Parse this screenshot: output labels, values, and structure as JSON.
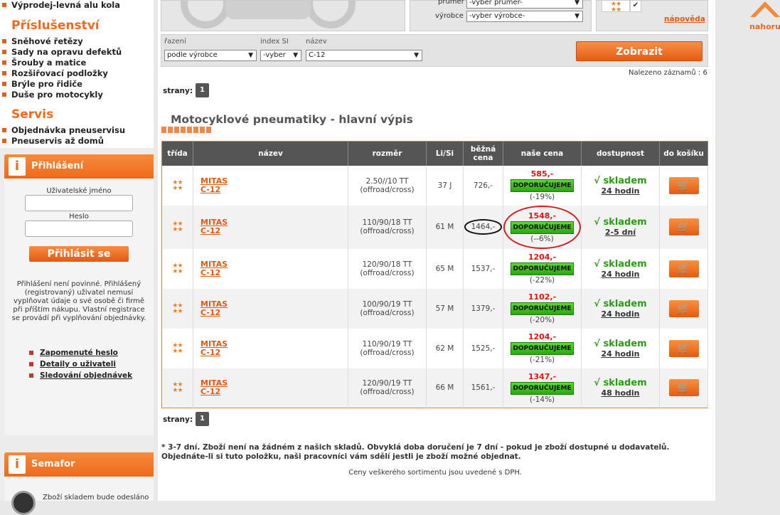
{
  "sidebar": {
    "top_item": "Výprodej-levná alu kola",
    "section_accessories": "Příslušenství",
    "accessories": [
      "Sněhové řetězy",
      "Sady na opravu defektů",
      "Šrouby a matice",
      "Rozšiřovací podložky",
      "Brýle pro řidiče",
      "Duše pro motocykly"
    ],
    "section_service": "Servis",
    "service": [
      "Objednávka pneuservisu",
      "Pneuservis až domů"
    ],
    "login": {
      "title": "Přihlášení",
      "username_label": "Uživatelské jméno",
      "password_label": "Heslo",
      "button": "Přihlásit se",
      "note": "Přihlášení není povinné. Přihlášený (registrovaný) uživatel nemusí vyplňovat údaje o své osobě či firmě při příštím nákupu. Vlastní registrace se provádí při vyplňování objednávky.",
      "links": [
        "Zapomenuté heslo",
        "Detaily o uživateli",
        "Sledování objednávek"
      ]
    },
    "semafor": {
      "title": "Semafor",
      "text": "Zboží skladem bude odesláno"
    }
  },
  "top": {
    "prumer_label": "průměr",
    "prumer_value": "-vyber průměr-",
    "vyrobce_label": "výrobce",
    "vyrobce_value": "-vyber výrobce-",
    "napoveda": "nápověda",
    "nahoru": "nahoru"
  },
  "filters": {
    "razeni_label": "řazení",
    "razeni_value": "podle výrobce",
    "index_label": "index SI",
    "index_value": "-vyber",
    "nazev_label": "název",
    "nazev_value": "C-12",
    "button": "Zobrazit"
  },
  "found": "Nalezeno záznamů : 6",
  "pages_label": "strany:",
  "page": "1",
  "heading": "Motocyklové pneumatiky - hlavní výpis",
  "table": {
    "headers": [
      "třída",
      "název",
      "rozměr",
      "Li/Si",
      "běžná cena",
      "naše cena",
      "dostupnost",
      "do košíku"
    ],
    "recommend": "DOPORUČUJEME",
    "stock": "√ skladem",
    "rows": [
      {
        "brand": "MITAS",
        "model": "C-12",
        "size": "2.50//10 TT",
        "use": "(offroad/cross)",
        "lisi": "37 J",
        "regular": "726,-",
        "price": "585,-",
        "discount": "(-19%)",
        "avail": "24 hodin"
      },
      {
        "brand": "MITAS",
        "model": "C-12",
        "size": "110/90/18 TT",
        "use": "(offroad/cross)",
        "lisi": "61 M",
        "regular": "1464,-",
        "price": "1548,-",
        "discount": "(--6%)",
        "avail": "2-5 dní"
      },
      {
        "brand": "MITAS",
        "model": "C-12",
        "size": "120/90/18 TT",
        "use": "(offroad/cross)",
        "lisi": "65 M",
        "regular": "1537,-",
        "price": "1204,-",
        "discount": "(-22%)",
        "avail": "24 hodin"
      },
      {
        "brand": "MITAS",
        "model": "C-12",
        "size": "100/90/19 TT",
        "use": "(offroad/cross)",
        "lisi": "57 M",
        "regular": "1379,-",
        "price": "1102,-",
        "discount": "(-20%)",
        "avail": "24 hodin"
      },
      {
        "brand": "MITAS",
        "model": "C-12",
        "size": "110/90/19 TT",
        "use": "(offroad/cross)",
        "lisi": "62 M",
        "regular": "1525,-",
        "price": "1204,-",
        "discount": "(-21%)",
        "avail": "24 hodin"
      },
      {
        "brand": "MITAS",
        "model": "C-12",
        "size": "120/90/19 TT",
        "use": "(offroad/cross)",
        "lisi": "66 M",
        "regular": "1561,-",
        "price": "1347,-",
        "discount": "(-14%)",
        "avail": "48 hodin"
      }
    ]
  },
  "footnote": "* 3-7 dní. Zboží není na žádném z našich skladů. Obvyklá doba doručení je 7 dní - pokud je zboží dostupné u dodavatelů. Objednáte-li si tuto položku, naši pracovníci vám sdělí jestli je zboží možné objednat.",
  "vat_note": "Ceny veškerého sortimentu jsou uvedené s DPH."
}
